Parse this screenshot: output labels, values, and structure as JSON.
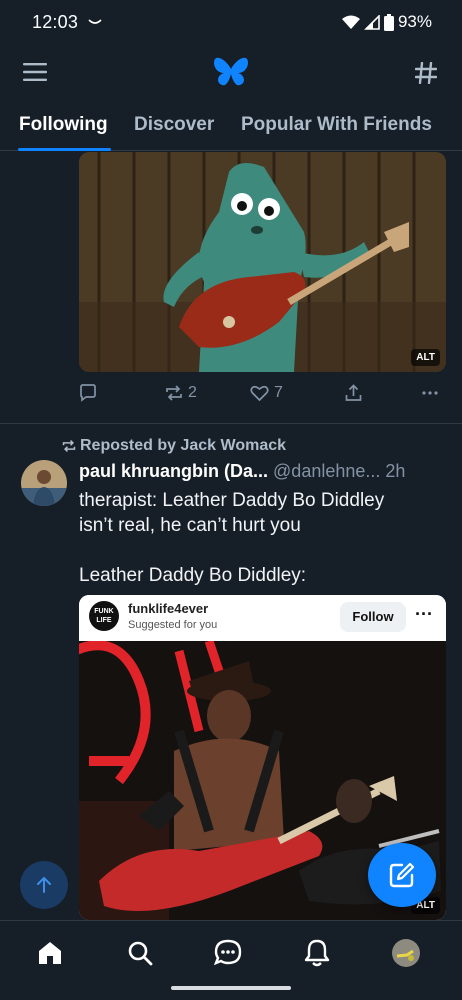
{
  "status_bar": {
    "time": "12:03",
    "battery": "93%"
  },
  "header": {
    "logo": "butterfly-icon",
    "menu_icon": "hamburger-icon",
    "feeds_icon": "hash-icon"
  },
  "tabs": [
    {
      "label": "Following",
      "active": true
    },
    {
      "label": "Discover",
      "active": false
    },
    {
      "label": "Popular With Friends",
      "active": false
    }
  ],
  "post1": {
    "alt_badge": "ALT",
    "actions": {
      "reply_count": "",
      "repost_count": "2",
      "like_count": "7"
    }
  },
  "post2": {
    "repost_label": "Reposted by Jack Womack",
    "author": "paul khruangbin (Da...",
    "handle": "@danlehne...",
    "time": "2h",
    "body": "therapist: Leather Daddy Bo Diddley\nisn’t real, he can’t hurt you\n\nLeather Daddy Bo Diddley:",
    "embed": {
      "account": "funklife4ever",
      "subtitle": "Suggested for you",
      "follow_label": "Follow",
      "logo_text": "FUNK LIFE",
      "alt_badge": "ALT"
    }
  },
  "colors": {
    "accent": "#1083fe",
    "background": "#161e27",
    "muted": "#8393a5"
  }
}
